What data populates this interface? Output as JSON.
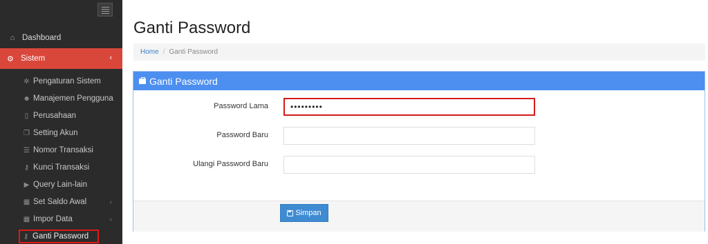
{
  "sidebar": {
    "dashboard": {
      "label": "Dashboard",
      "icon": "home-icon"
    },
    "sistem": {
      "label": "Sistem",
      "icon": "cogs-icon"
    },
    "items": [
      {
        "label": "Pengaturan Sistem",
        "icon": "gear-icon"
      },
      {
        "label": "Manajemen Pengguna",
        "icon": "users-icon"
      },
      {
        "label": "Perusahaan",
        "icon": "clipboard-icon"
      },
      {
        "label": "Setting Akun",
        "icon": "copy-icon"
      },
      {
        "label": "Nomor Transaksi",
        "icon": "list-icon"
      },
      {
        "label": "Kunci Transaksi",
        "icon": "key-icon"
      },
      {
        "label": "Query Lain-lain",
        "icon": "play-icon"
      },
      {
        "label": "Set Saldo Awal",
        "icon": "calculator-icon"
      },
      {
        "label": "Impor Data",
        "icon": "calculator-icon"
      },
      {
        "label": "Ganti Password",
        "icon": "key-icon"
      }
    ]
  },
  "page": {
    "title": "Ganti Password"
  },
  "breadcrumb": {
    "home": "Home",
    "separator": "/",
    "current": "Ganti Password"
  },
  "panel": {
    "title": "Ganti Password",
    "fields": {
      "old_password": {
        "label": "Password Lama",
        "value": "•••••••••"
      },
      "new_password": {
        "label": "Password Baru",
        "value": ""
      },
      "repeat_password": {
        "label": "Ulangi Password Baru",
        "value": ""
      }
    },
    "save_label": "Simpan"
  },
  "colors": {
    "sidebar_bg": "#2b2b2b",
    "active_item": "#d9473a",
    "panel_header": "#4c8ff0",
    "button": "#3f8bd2",
    "highlight": "#e01818"
  }
}
